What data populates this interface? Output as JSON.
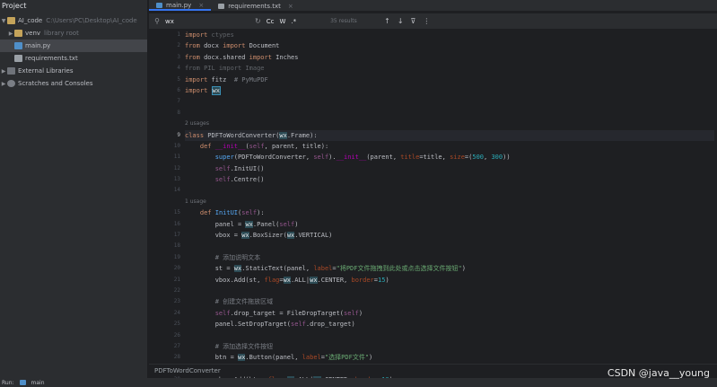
{
  "project": {
    "title": "Project",
    "tree": [
      {
        "label": "AI_code",
        "hint": "C:\\Users\\PC\\Desktop\\AI_code",
        "icon": "folder-icon"
      },
      {
        "label": "venv",
        "hint": "library root",
        "icon": "folder-icon"
      },
      {
        "label": "main.py",
        "hint": "",
        "icon": "python-file-icon"
      },
      {
        "label": "requirements.txt",
        "hint": "",
        "icon": "text-file-icon"
      },
      {
        "label": "External Libraries",
        "hint": "",
        "icon": "library-icon"
      },
      {
        "label": "Scratches and Consoles",
        "hint": "",
        "icon": "scratch-icon"
      }
    ]
  },
  "tabs": [
    {
      "label": "main.py",
      "active": true
    },
    {
      "label": "requirements.txt",
      "active": false
    }
  ],
  "find": {
    "query": "wx",
    "opt_case": "Cc",
    "opt_word": "W",
    "opt_regex": ".*",
    "results": "35 results"
  },
  "gutter": {
    "lines": [
      "1",
      "2",
      "3",
      "4",
      "5",
      "6",
      "7",
      "8",
      "9",
      "10",
      "11",
      "12",
      "13",
      "14",
      "15",
      "16",
      "17",
      "18",
      "19",
      "20",
      "21",
      "22",
      "23",
      "24",
      "25",
      "26",
      "27",
      "28",
      "29",
      "30"
    ]
  },
  "code": {
    "usages_1": "2 usages",
    "usages_2": "1 usage"
  },
  "breadcrumb": "PDFToWordConverter",
  "runbar": {
    "run_label": "Run:",
    "config": "main"
  },
  "watermark": "CSDN @java__young",
  "colors": {
    "background": "#1e1f22",
    "panel": "#2b2d30",
    "keyword": "#cf8e6d",
    "string": "#6aab73",
    "number": "#2aacb8",
    "self": "#94558d",
    "accent": "#3574f0"
  }
}
